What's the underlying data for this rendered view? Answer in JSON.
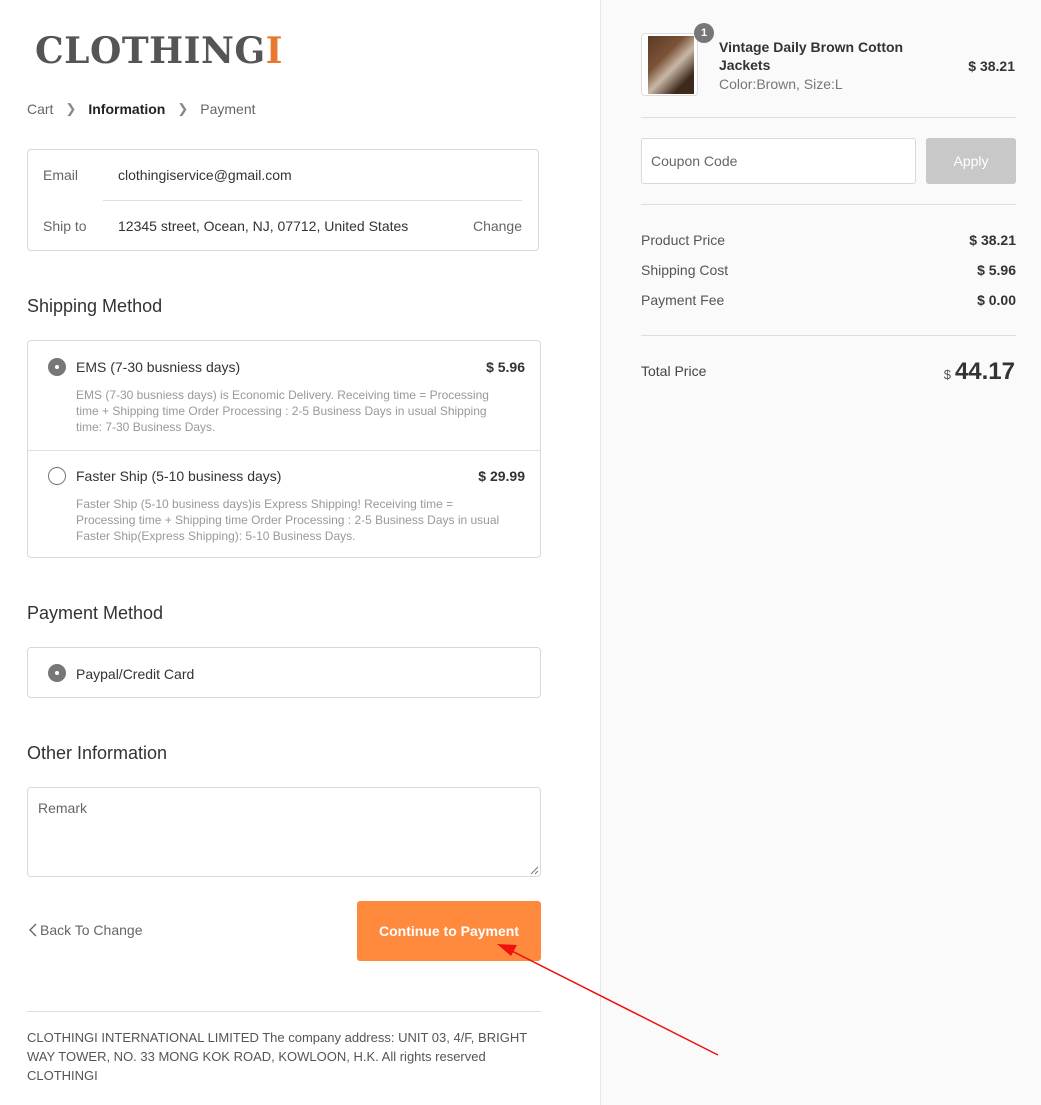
{
  "brand": {
    "name": "CLOTHING",
    "accent_letter": "I",
    "accent_color": "#e8782e"
  },
  "breadcrumb": {
    "items": [
      "Cart",
      "Information",
      "Payment"
    ],
    "active": "Information"
  },
  "info": {
    "email_label": "Email",
    "email_value": "clothingiservice@gmail.com",
    "ship_label": "Ship to",
    "ship_value": "12345 street, Ocean, NJ, 07712, United States",
    "change_label": "Change"
  },
  "shipping": {
    "title": "Shipping Method",
    "options": [
      {
        "name": "EMS (7-30 busniess days)",
        "price": "$ 5.96",
        "selected": true,
        "description": "EMS (7-30 busniess days) is Economic Delivery. Receiving time = Processing time + Shipping time Order Processing : 2-5 Business Days in usual Shipping time: 7-30 Business Days."
      },
      {
        "name": "Faster Ship (5-10 business days)",
        "price": "$ 29.99",
        "selected": false,
        "description": "Faster Ship (5-10 business days)is Express Shipping! Receiving time = Processing time + Shipping time Order Processing : 2-5 Business Days in usual Faster Ship(Express Shipping): 5-10 Business Days."
      }
    ]
  },
  "payment": {
    "title": "Payment Method",
    "option": "Paypal/Credit Card",
    "selected": true
  },
  "other": {
    "title": "Other Information",
    "remark_placeholder": "Remark"
  },
  "actions": {
    "back_label": "Back To Change",
    "continue_label": "Continue to Payment",
    "continue_color": "#ff8a3d"
  },
  "footer": {
    "text": "CLOTHINGI INTERNATIONAL LIMITED The company address: UNIT 03, 4/F, BRIGHT WAY TOWER, NO. 33 MONG KOK ROAD, KOWLOON, H.K. All rights reserved CLOTHINGI"
  },
  "cart": {
    "item_count": "1",
    "product_name": "Vintage Daily Brown Cotton Jackets",
    "product_variant": "Color:Brown, Size:L",
    "product_price": "$ 38.21"
  },
  "coupon": {
    "placeholder": "Coupon Code",
    "apply_label": "Apply"
  },
  "summary": {
    "rows": [
      {
        "label": "Product Price",
        "value": "$ 38.21"
      },
      {
        "label": "Shipping Cost",
        "value": "$ 5.96"
      },
      {
        "label": "Payment Fee",
        "value": "$ 0.00"
      }
    ],
    "total_label": "Total Price",
    "total_currency": "$",
    "total_value": "44.17"
  },
  "annotation": {
    "arrow_color": "#ee1111"
  }
}
